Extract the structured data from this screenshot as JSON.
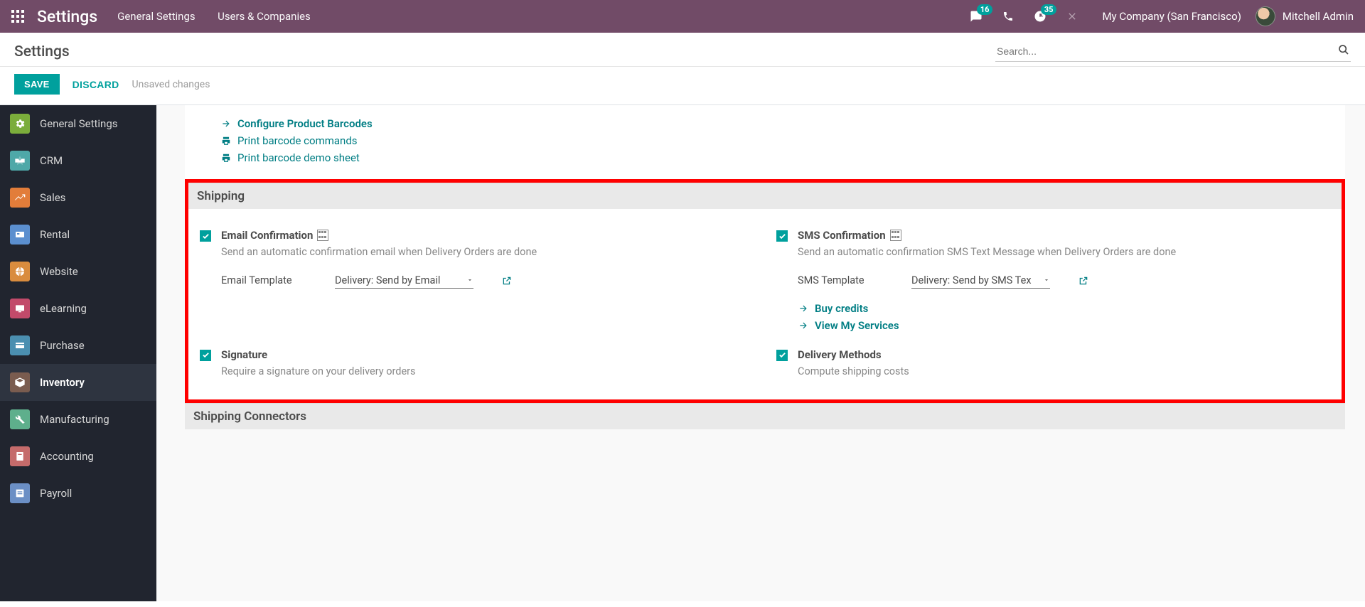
{
  "topbar": {
    "brand": "Settings",
    "nav1": "General Settings",
    "nav2": "Users & Companies",
    "msg_count": "16",
    "activity_count": "35",
    "company": "My Company (San Francisco)",
    "user": "Mitchell Admin"
  },
  "subhead": {
    "title": "Settings",
    "search_placeholder": "Search..."
  },
  "actions": {
    "save": "SAVE",
    "discard": "DISCARD",
    "unsaved": "Unsaved changes"
  },
  "sidebar": {
    "items": [
      {
        "label": "General Settings"
      },
      {
        "label": "CRM"
      },
      {
        "label": "Sales"
      },
      {
        "label": "Rental"
      },
      {
        "label": "Website"
      },
      {
        "label": "eLearning"
      },
      {
        "label": "Purchase"
      },
      {
        "label": "Inventory"
      },
      {
        "label": "Manufacturing"
      },
      {
        "label": "Accounting"
      },
      {
        "label": "Payroll"
      }
    ]
  },
  "barcode": {
    "configure": "Configure Product Barcodes",
    "print_cmds": "Print barcode commands",
    "print_demo": "Print barcode demo sheet"
  },
  "sections": {
    "shipping": "Shipping",
    "connectors": "Shipping Connectors"
  },
  "settings": {
    "email": {
      "title": "Email Confirmation",
      "desc": "Send an automatic confirmation email when Delivery Orders are done",
      "field_label": "Email Template",
      "field_value": "Delivery: Send by Email"
    },
    "sms": {
      "title": "SMS Confirmation",
      "desc": "Send an automatic confirmation SMS Text Message when Delivery Orders are done",
      "field_label": "SMS Template",
      "field_value": "Delivery: Send by SMS Tex",
      "buy": "Buy credits",
      "view": "View My Services"
    },
    "signature": {
      "title": "Signature",
      "desc": "Require a signature on your delivery orders"
    },
    "delivery": {
      "title": "Delivery Methods",
      "desc": "Compute shipping costs"
    }
  }
}
